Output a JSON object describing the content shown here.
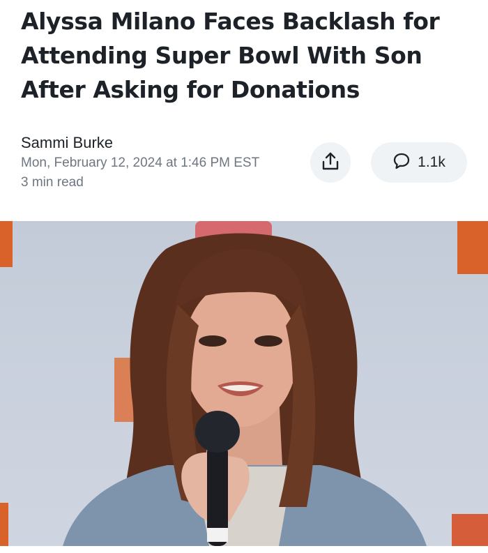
{
  "article": {
    "headline": "Alyssa Milano Faces Backlash for Attending Super Bowl With Son After Asking for Donations",
    "author": "Sammi Burke",
    "date": "Mon, February 12, 2024 at 1:46 PM EST",
    "read_time": "3 min read"
  },
  "actions": {
    "share_icon": "share-icon",
    "comment_icon": "comment-bubble-icon",
    "comment_count": "1.1k"
  },
  "colors": {
    "headline": "#1d2228",
    "meta": "#6e7780",
    "button_bg": "#f0f3f5"
  }
}
